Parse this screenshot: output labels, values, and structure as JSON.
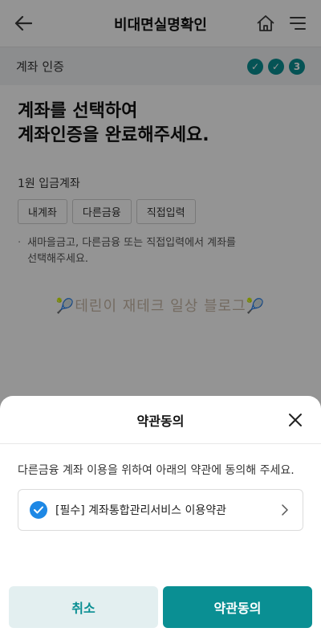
{
  "header": {
    "title": "비대면실명확인",
    "back_icon": "arrow-left-icon",
    "home_icon": "home-icon",
    "menu_icon": "hamburger-menu-icon"
  },
  "stepbar": {
    "label": "계좌 인증",
    "steps": [
      "✓",
      "✓",
      "3"
    ]
  },
  "content": {
    "headline_line1": "계좌를 선택하여",
    "headline_line2": "계좌인증을 완료해주세요.",
    "section_label": "1원 입금계좌",
    "chips": [
      "내계좌",
      "다른금융",
      "직접입력"
    ],
    "note_bullet": "·",
    "note_line1": "새마을금고, 다른금융 또는 직접입력에서 계좌를",
    "note_line2": "선택해주세요.",
    "watermark": "🎾테린이 재테크 일상 블로그🎾"
  },
  "sheet": {
    "title": "약관동의",
    "close_icon": "close-icon",
    "description": "다른금융 계좌 이용을 위하여 아래의 약관에 동의해 주세요.",
    "agreement_item": "[필수] 계좌통합관리서비스 이용약관",
    "cancel_label": "취소",
    "agree_label": "약관동의"
  },
  "colors": {
    "accent": "#0a8f93",
    "check_blue": "#1e88e5",
    "cancel_bg": "#e3eff0"
  }
}
